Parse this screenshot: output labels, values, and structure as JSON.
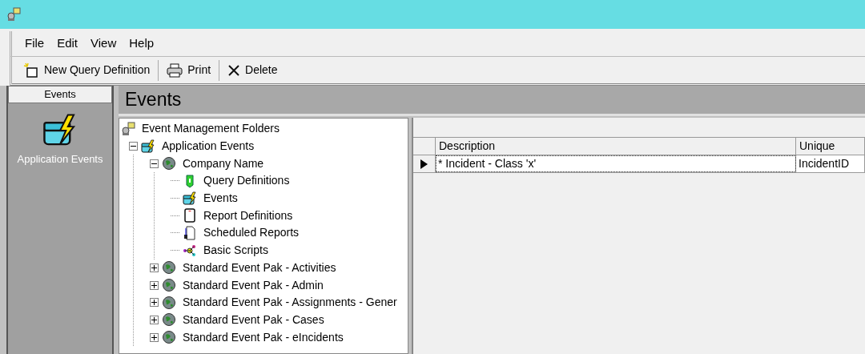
{
  "menu": [
    "File",
    "Edit",
    "View",
    "Help"
  ],
  "toolbar": [
    {
      "kind": "new",
      "label": "New Query Definition"
    },
    {
      "kind": "print",
      "label": "Print"
    },
    {
      "kind": "delete",
      "label": "Delete"
    }
  ],
  "sidebar": {
    "header": "Events",
    "items": [
      {
        "kind": "events",
        "label": "Application Events",
        "selected": true
      }
    ]
  },
  "panel_title": "Events",
  "tree": [
    {
      "kind": "root",
      "label": "Event Management Folders",
      "children": [
        {
          "kind": "events",
          "label": "Application Events",
          "expanded": true,
          "children": [
            {
              "kind": "globe",
              "label": "Company Name",
              "expanded": true,
              "children": [
                {
                  "kind": "query",
                  "label": "Query Definitions"
                },
                {
                  "kind": "events",
                  "label": "Events"
                },
                {
                  "kind": "report",
                  "label": "Report Definitions"
                },
                {
                  "kind": "scheduled",
                  "label": "Scheduled Reports"
                },
                {
                  "kind": "scripts",
                  "label": "Basic Scripts"
                }
              ]
            },
            {
              "kind": "globe",
              "label": "Standard Event Pak - Activities",
              "expanded": false
            },
            {
              "kind": "globe",
              "label": "Standard Event Pak - Admin",
              "expanded": false
            },
            {
              "kind": "globe",
              "label": "Standard Event Pak - Assignments - Gener",
              "expanded": false
            },
            {
              "kind": "globe",
              "label": "Standard Event Pak - Cases",
              "expanded": false
            },
            {
              "kind": "globe",
              "label": "Standard Event Pak - eIncidents",
              "expanded": false
            }
          ]
        }
      ]
    }
  ],
  "grid": {
    "columns": [
      "Description",
      "Unique"
    ],
    "rows": [
      {
        "cells": [
          "* Incident - Class 'x'",
          "IncidentID"
        ],
        "selected": true
      }
    ]
  }
}
